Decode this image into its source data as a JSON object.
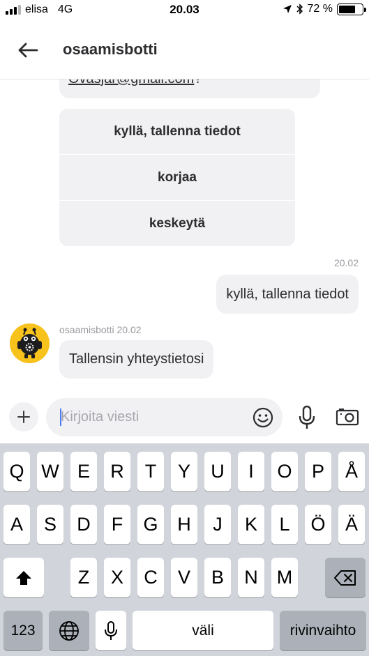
{
  "status_bar": {
    "carrier": "elisa",
    "network": "4G",
    "time": "20.03",
    "battery": "72 %",
    "battery_level": 0.72
  },
  "header": {
    "title": "osaamisbotti"
  },
  "chat": {
    "prev_message_partial": "Ovasjar@gmail.com",
    "prev_message_tail": "?",
    "choices": [
      "kyllä, tallenna tiedot",
      "korjaa",
      "keskeytä"
    ],
    "user_message": {
      "time": "20.02",
      "text": "kyllä, tallenna tiedot"
    },
    "bot_message": {
      "sender": "osaamisbotti",
      "time": "20.02",
      "text": "Tallensin yhteystietosi"
    }
  },
  "composer": {
    "placeholder": "Kirjoita viesti"
  },
  "keyboard": {
    "row1": [
      "Q",
      "W",
      "E",
      "R",
      "T",
      "Y",
      "U",
      "I",
      "O",
      "P",
      "Å"
    ],
    "row2": [
      "A",
      "S",
      "D",
      "F",
      "G",
      "H",
      "J",
      "K",
      "L",
      "Ö",
      "Ä"
    ],
    "row3": [
      "Z",
      "X",
      "C",
      "V",
      "B",
      "N",
      "M"
    ],
    "numbers_label": "123",
    "space_label": "väli",
    "return_label": "rivinvaihto"
  },
  "colors": {
    "bubble": "#f1f1f4",
    "avatar": "#f7c21b",
    "keyboard_bg": "#d1d4da",
    "caret": "#4a7cf3"
  }
}
